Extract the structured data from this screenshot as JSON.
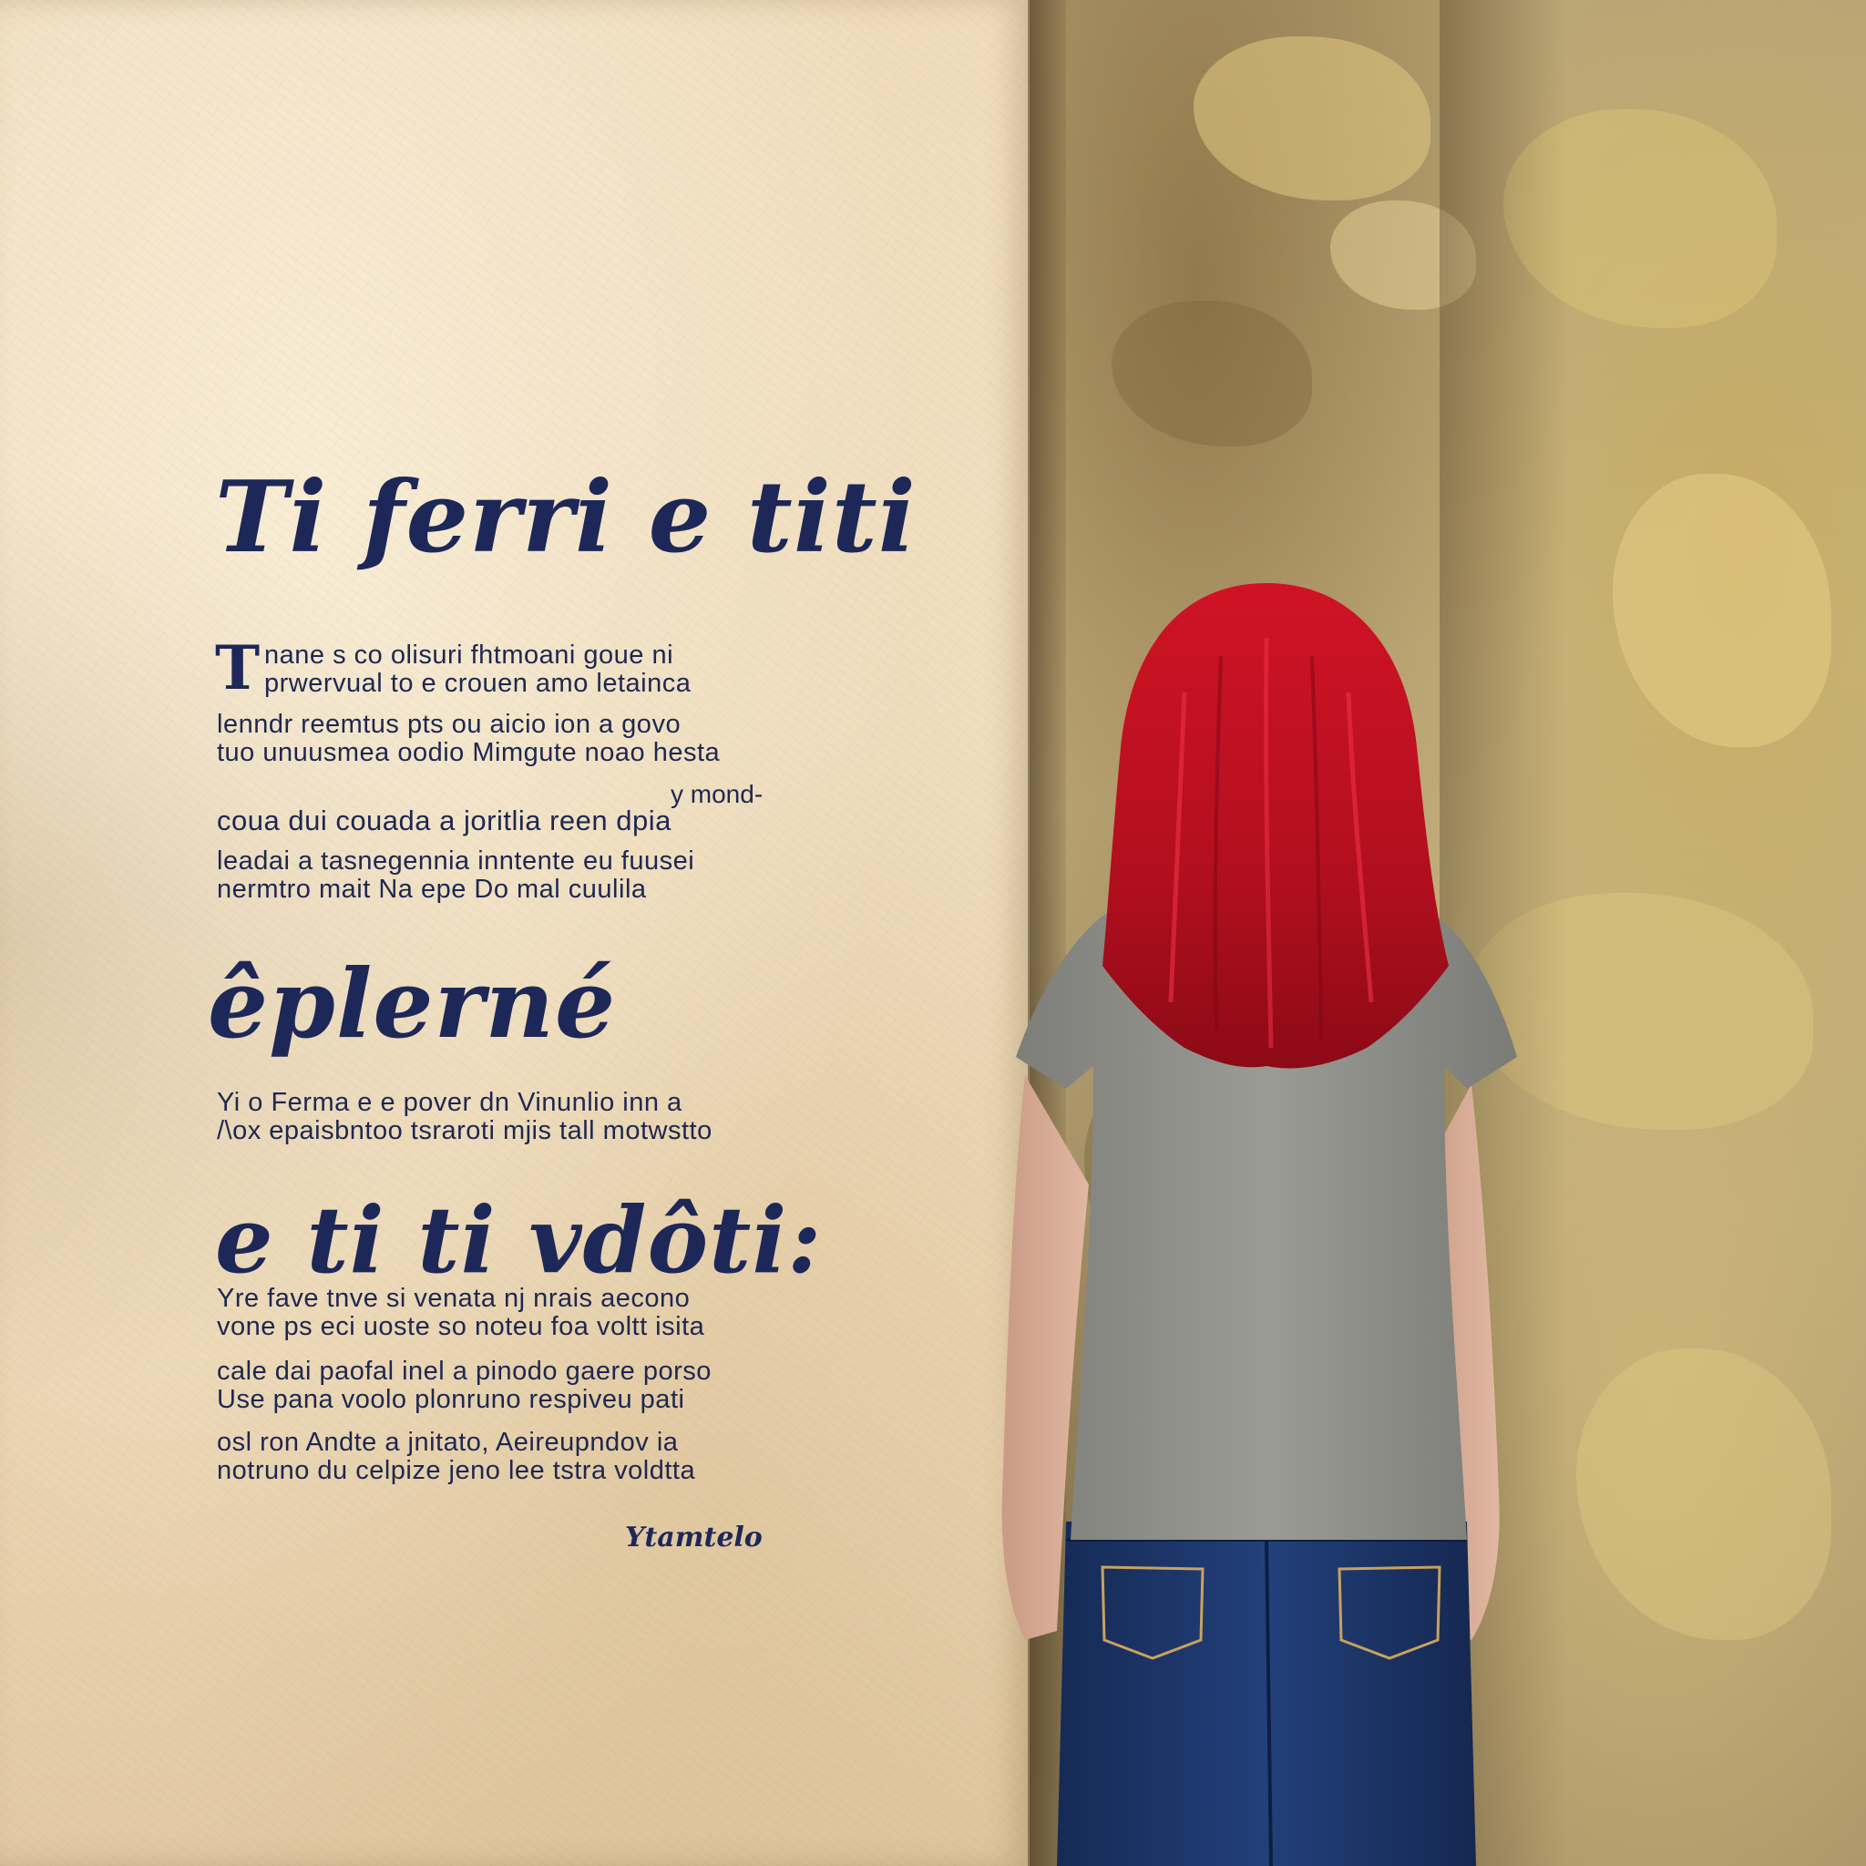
{
  "heading_1": "Ti ferri e titi",
  "dropcap": "T",
  "para_1": [
    "nane s co olisuri fhtmoani goue ni",
    "prwervual to e crouen amo letainca"
  ],
  "para_2": [
    "lenndr reemtus pts ou aicio ion a govo",
    "tuo unuusmea oodio Mimgute noao hesta"
  ],
  "aside": "y mond-",
  "para_3": [
    "coua dui couada a joritlia reen dpia"
  ],
  "para_4": [
    "leadai a tasnegennia inntente eu fuusei",
    "nermtro mait Na epe Do mal cuulila"
  ],
  "heading_2": "êplerné",
  "para_5": [
    "Yi o Ferma e e pover dn Vinunlio inn a",
    "/\\ox epaisbntoo tsraroti mjis tall motwstto"
  ],
  "heading_3": "e ti ti vdôti:",
  "para_6": [
    "Yre fave tnve si venata nj nrais aecono",
    "vone ps eci uoste so noteu foa voltt isita"
  ],
  "para_7": [
    "cale dai paofal inel a pinodo gaere porso",
    "Use pana voolo plonruno respiveu pati"
  ],
  "para_8": [
    "osl ron Andte a jnitato, Aeireupndov ia",
    "notruno du celpize jeno lee tstra voldtta"
  ],
  "signature": "Ytamtelo",
  "colors": {
    "ink": "#1d2858",
    "paper": "#efdcbc",
    "wall": "#bca878",
    "hair": "#b8101e",
    "shirt": "#8c8d88",
    "jeans": "#1e3566"
  }
}
